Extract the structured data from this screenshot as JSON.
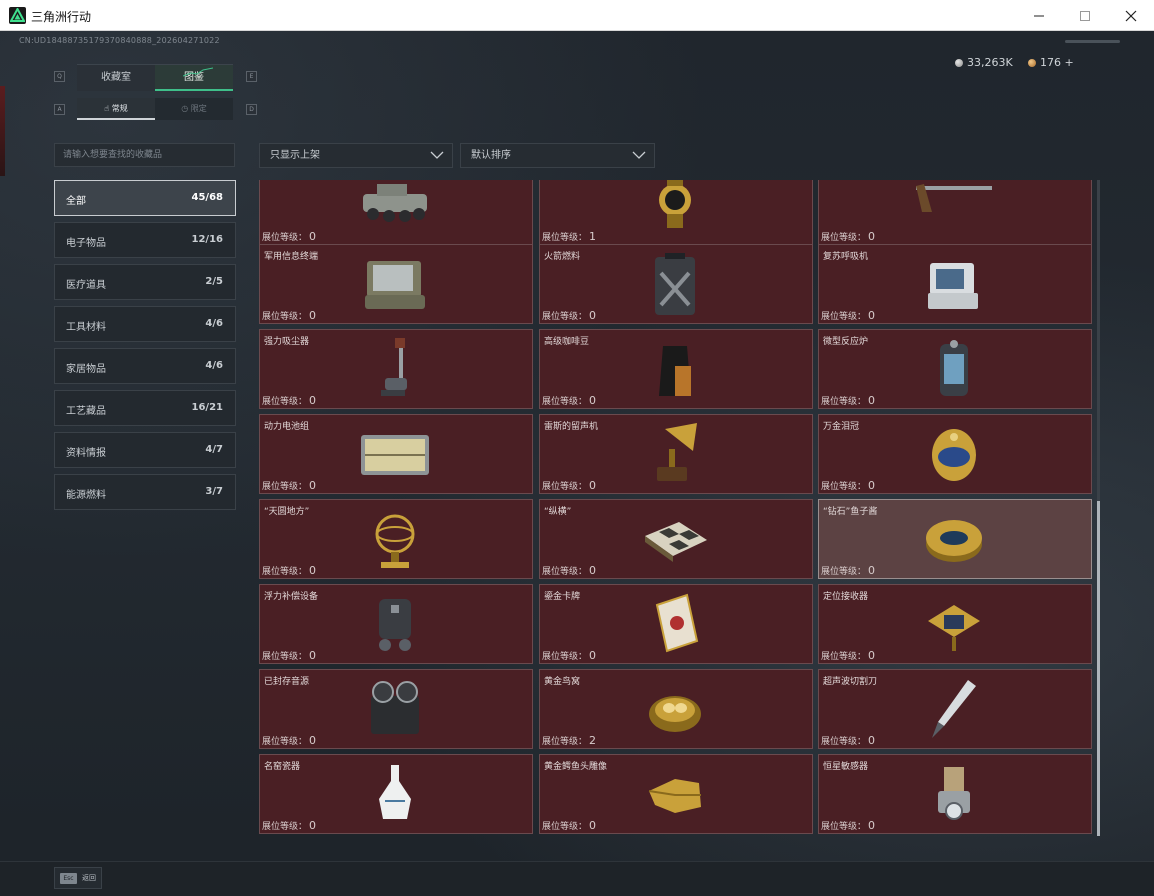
{
  "window": {
    "title": "三角洲行动"
  },
  "header": {
    "uid": "CN:UD18488735179370840888_202604271022",
    "currency1": "33,263K",
    "currency2": "176 +"
  },
  "tabs": {
    "collection": "收藏室",
    "catalog": "图鉴"
  },
  "subtabs": {
    "normal": "常规",
    "limited": "限定"
  },
  "search": {
    "placeholder": "请输入想要查找的收藏品"
  },
  "filters": {
    "shelf": "只显示上架",
    "sort": "默认排序"
  },
  "categories": [
    {
      "name": "全部",
      "count": "45/68"
    },
    {
      "name": "电子物品",
      "count": "12/16"
    },
    {
      "name": "医疗道具",
      "count": "2/5"
    },
    {
      "name": "工具材料",
      "count": "4/6"
    },
    {
      "name": "家居物品",
      "count": "4/6"
    },
    {
      "name": "工艺藏品",
      "count": "16/21"
    },
    {
      "name": "资料情报",
      "count": "4/7"
    },
    {
      "name": "能源燃料",
      "count": "3/7"
    }
  ],
  "level_label": "展位等级：",
  "items": [
    {
      "name": "",
      "level": "0",
      "icon": "armored-vehicle"
    },
    {
      "name": "",
      "level": "1",
      "icon": "gold-watch"
    },
    {
      "name": "",
      "level": "0",
      "icon": "antique-rifle"
    },
    {
      "name": "军用信息终端",
      "level": "0",
      "icon": "military-terminal"
    },
    {
      "name": "火箭燃料",
      "level": "0",
      "icon": "rocket-fuel-canister"
    },
    {
      "name": "复苏呼吸机",
      "level": "0",
      "icon": "ventilator"
    },
    {
      "name": "强力吸尘器",
      "level": "0",
      "icon": "vacuum-cleaner"
    },
    {
      "name": "高级咖啡豆",
      "level": "0",
      "icon": "coffee-bag"
    },
    {
      "name": "微型反应炉",
      "level": "0",
      "icon": "mini-reactor"
    },
    {
      "name": "动力电池组",
      "level": "0",
      "icon": "battery-pack"
    },
    {
      "name": "雷斯的留声机",
      "level": "0",
      "icon": "gramophone"
    },
    {
      "name": "万金泪冠",
      "level": "0",
      "icon": "jeweled-egg"
    },
    {
      "name": "“天圆地方”",
      "level": "0",
      "icon": "armillary-sphere"
    },
    {
      "name": "“纵横”",
      "level": "0",
      "icon": "chess-board"
    },
    {
      "name": "“钻石”鱼子酱",
      "level": "0",
      "icon": "caviar-tin"
    },
    {
      "name": "浮力补偿设备",
      "level": "0",
      "icon": "buoyancy-device"
    },
    {
      "name": "鎏金卡牌",
      "level": "0",
      "icon": "gilded-card"
    },
    {
      "name": "定位接收器",
      "level": "0",
      "icon": "gps-receiver"
    },
    {
      "name": "已封存音源",
      "level": "0",
      "icon": "reel-recorder"
    },
    {
      "name": "黄金鸟窝",
      "level": "2",
      "icon": "golden-nest"
    },
    {
      "name": "超声波切割刀",
      "level": "0",
      "icon": "ultrasonic-knife"
    },
    {
      "name": "名窑瓷器",
      "level": "0",
      "icon": "porcelain-vase"
    },
    {
      "name": "黄金鳄鱼头雕像",
      "level": "0",
      "icon": "golden-croc-head"
    },
    {
      "name": "恒星敏感器",
      "level": "0",
      "icon": "star-sensor"
    }
  ],
  "footer": {
    "esc_key": "Esc",
    "esc_label": "返回"
  }
}
